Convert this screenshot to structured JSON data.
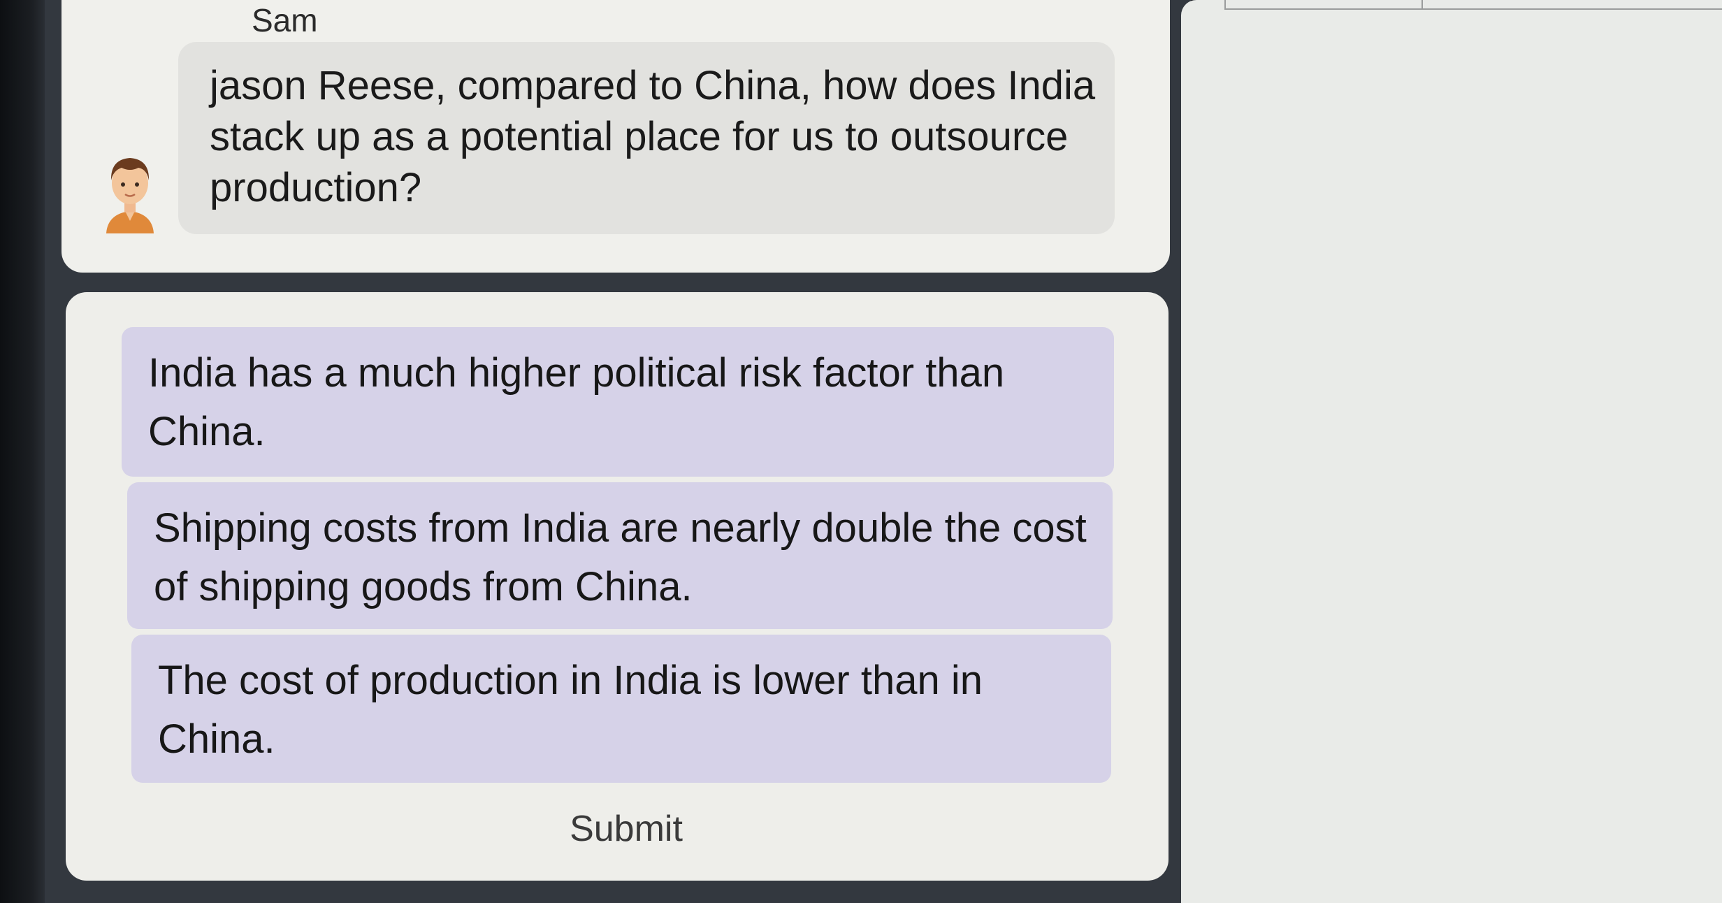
{
  "conversation": {
    "sender_name": "Sam",
    "avatar_icon": "person-avatar-icon",
    "message": "jason Reese, compared to China, how does India stack up as a potential place for us to outsource production?"
  },
  "answers": {
    "options": [
      "India has a much higher political risk factor than China.",
      "Shipping costs from India are nearly double the cost of shipping goods from China.",
      "The cost of production in India is lower than in China."
    ],
    "submit_label": "Submit"
  },
  "colors": {
    "option_background": "#d6d2e8",
    "card_background": "#efefeb",
    "panel_background": "#33383f"
  }
}
